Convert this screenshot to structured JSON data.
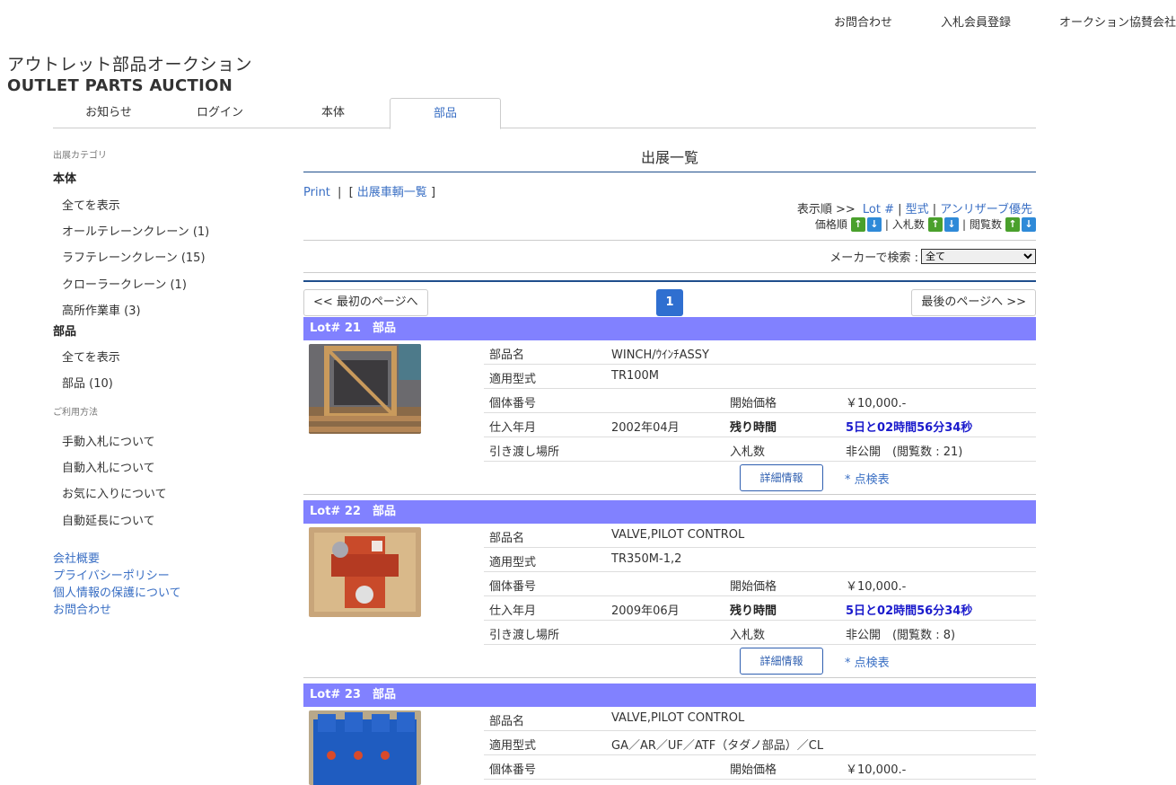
{
  "topnav": [
    "お問合わせ",
    "入札会員登録",
    "オークション協賛会社"
  ],
  "brand": {
    "jp": "アウトレット部品オークション",
    "en": "OUTLET PARTS AUCTION"
  },
  "tabs": [
    "お知らせ",
    "ログイン",
    "本体",
    "部品"
  ],
  "active_tab": "部品",
  "sidebar": {
    "caption_category": "出展カテゴリ",
    "group1_title": "本体",
    "group1_items": [
      "全てを表示",
      "オールテレーンクレーン (1)",
      "ラフテレーンクレーン (15)",
      "クローラークレーン (1)",
      "高所作業車 (3)"
    ],
    "group2_title": "部品",
    "group2_items": [
      "全てを表示",
      "部品 (10)"
    ],
    "caption_usage": "ご利用方法",
    "usage_items": [
      "手動入札について",
      "自動入札について",
      "お気に入りについて",
      "自動延長について"
    ],
    "links": [
      "会社概要",
      "プライバシーポリシー",
      "個人情報の保護について",
      "お問合わせ"
    ]
  },
  "main": {
    "title": "出展一覧",
    "print": "Print",
    "sep": "|",
    "vehicle_list": "出展車輌一覧",
    "sort_label": "表示順 >>",
    "sort_lot": "Lot #",
    "sort_model": "型式",
    "sort_unreserve": "アンリザーブ優先",
    "price_order": "価格順",
    "bid_count": "入札数",
    "view_count": "閲覧数",
    "maker_label": "メーカーで検索 :",
    "maker_value": "全て",
    "first_page": "<< 最初のページへ",
    "page": "1",
    "last_page": "最後のページへ >>",
    "detail_label": "詳細情報",
    "inspect_label": "* 点検表"
  },
  "labels": {
    "part_name": "部品名",
    "model": "適用型式",
    "serial": "個体番号",
    "start_price": "開始価格",
    "purchase_date": "仕入年月",
    "remaining": "残り時間",
    "location": "引き渡し場所",
    "bids": "入札数"
  },
  "lots": [
    {
      "head": "Lot# 21　部品",
      "part_name": "WINCH/ｳｲﾝﾁASSY",
      "model": "TR100M",
      "serial": "",
      "start_price": "￥10,000.-",
      "purchase_date": "2002年04月",
      "remaining": "5日と02時間56分34秒",
      "location": "",
      "bids": "非公開　(閲覧数 : 21)"
    },
    {
      "head": "Lot# 22　部品",
      "part_name": "VALVE,PILOT CONTROL",
      "model": "TR350M-1,2",
      "serial": "",
      "start_price": "￥10,000.-",
      "purchase_date": "2009年06月",
      "remaining": "5日と02時間56分34秒",
      "location": "",
      "bids": "非公開　(閲覧数 : 8)"
    },
    {
      "head": "Lot# 23　部品",
      "part_name": "VALVE,PILOT CONTROL",
      "model": "GA／AR／UF／ATF（タダノ部品）／CL",
      "serial": "",
      "start_price": "￥10,000.-"
    }
  ]
}
